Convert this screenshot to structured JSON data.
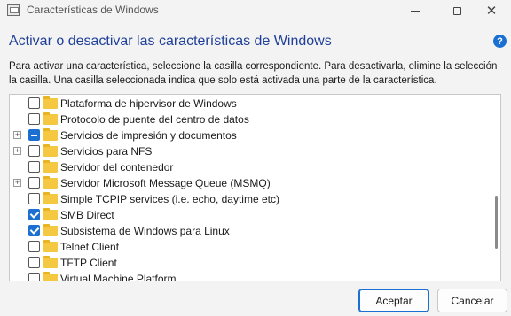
{
  "window": {
    "title": "Características de Windows",
    "close_glyph": "✕"
  },
  "dialog": {
    "heading": "Activar o desactivar las características de Windows",
    "help_glyph": "?",
    "description": "Para activar una característica, seleccione la casilla correspondiente. Para desactivarla, elimine la selección la casilla. Una casilla seleccionada indica que solo está activada una parte de la característica."
  },
  "features": [
    {
      "label": "Plataforma de hipervisor de Windows",
      "state": "unchecked",
      "expandable": false
    },
    {
      "label": "Protocolo de puente del centro de datos",
      "state": "unchecked",
      "expandable": false
    },
    {
      "label": "Servicios de impresión y documentos",
      "state": "partial",
      "expandable": true
    },
    {
      "label": "Servicios para NFS",
      "state": "unchecked",
      "expandable": true
    },
    {
      "label": "Servidor del contenedor",
      "state": "unchecked",
      "expandable": false
    },
    {
      "label": "Servidor Microsoft Message Queue (MSMQ)",
      "state": "unchecked",
      "expandable": true
    },
    {
      "label": "Simple TCPIP services (i.e. echo, daytime etc)",
      "state": "unchecked",
      "expandable": false
    },
    {
      "label": "SMB Direct",
      "state": "checked",
      "expandable": false
    },
    {
      "label": "Subsistema de Windows para Linux",
      "state": "checked",
      "expandable": false
    },
    {
      "label": "Telnet Client",
      "state": "unchecked",
      "expandable": false
    },
    {
      "label": "TFTP Client",
      "state": "unchecked",
      "expandable": false
    },
    {
      "label": "Virtual Machine Platform",
      "state": "unchecked",
      "expandable": false
    }
  ],
  "expander_glyph": "+",
  "buttons": {
    "ok": "Aceptar",
    "cancel": "Cancelar"
  },
  "colors": {
    "accent": "#1a6fd1",
    "heading": "#1f3f99",
    "folder": "#f5c842"
  }
}
